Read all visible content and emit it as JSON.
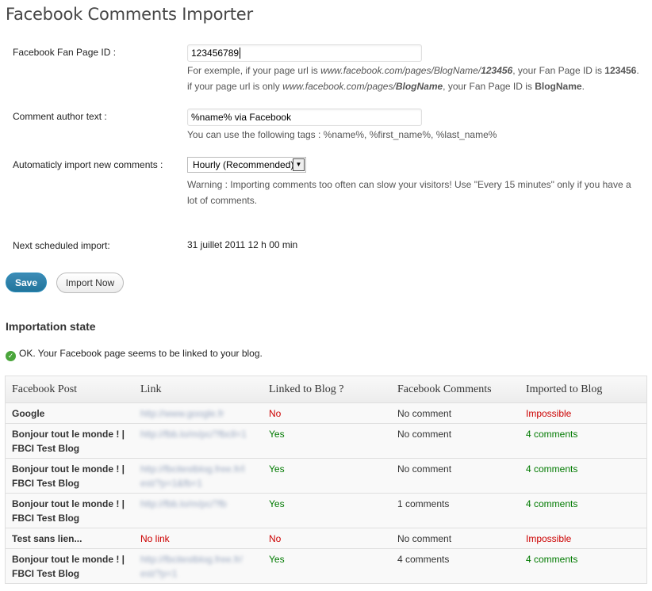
{
  "title": "Facebook Comments Importer",
  "form": {
    "fanpage_label": "Facebook Fan Page ID :",
    "fanpage_value": "123456789",
    "fanpage_help_1_a": "For exemple, if your page url is ",
    "fanpage_help_1_b": "www.facebook.com/pages/BlogName/",
    "fanpage_help_1_c": "123456",
    "fanpage_help_1_d": ", your Fan Page ID is ",
    "fanpage_help_1_e": "123456",
    "fanpage_help_1_f": ".",
    "fanpage_help_2_a": "if your page url is only ",
    "fanpage_help_2_b": "www.facebook.com/pages/",
    "fanpage_help_2_c": "BlogName",
    "fanpage_help_2_d": ", your Fan Page ID is ",
    "fanpage_help_2_e": "BlogName",
    "fanpage_help_2_f": ".",
    "author_label": "Comment author text :",
    "author_value": "%name% via Facebook",
    "author_help": "You can use the following tags : %name%, %first_name%, %last_name%",
    "auto_label": "Automaticly import new comments :",
    "auto_value": "Hourly (Recommended)",
    "auto_warning_1": "Warning : Importing comments too often can slow your visitors! Use \"Every 15 minutes\" only if you have a",
    "auto_warning_2": "lot of comments.",
    "next_label": "Next scheduled import:",
    "next_value": "31 juillet 2011 12 h 00 min"
  },
  "buttons": {
    "save": "Save",
    "import": "Import Now"
  },
  "state": {
    "heading": "Importation state",
    "status": "OK. Your Facebook page seems to be linked to your blog."
  },
  "table": {
    "headers": [
      "Facebook Post",
      "Link",
      "Linked to Blog ?",
      "Facebook Comments",
      "Imported to Blog"
    ],
    "rows": [
      {
        "post_1": "Google",
        "post_2": "",
        "link_1": "http://www.google.fr",
        "link_2": "",
        "linked": "No",
        "fb": "No comment",
        "imported": "Impossible"
      },
      {
        "post_1": "Bonjour tout le monde ! |",
        "post_2": "FBCI Test Blog",
        "link_1": "http://fbb.lo/m/pc/?fbcll=1",
        "link_2": "",
        "linked": "Yes",
        "fb": "No comment",
        "imported": "4 comments"
      },
      {
        "post_1": "Bonjour tout le monde ! |",
        "post_2": "FBCI Test Blog",
        "link_1": "http://fbcitestblog.free.fr/l",
        "link_2": "est/?p=1&fb=1",
        "linked": "Yes",
        "fb": "No comment",
        "imported": "4 comments"
      },
      {
        "post_1": "Bonjour tout le monde ! |",
        "post_2": "FBCI Test Blog",
        "link_1": "http://fbb.lo/m/pc/?fb",
        "link_2": "",
        "linked": "Yes",
        "fb": "1 comments",
        "imported": "4 comments"
      },
      {
        "post_1": "Test sans lien...",
        "post_2": "",
        "link_1": "No link",
        "link_2": "",
        "linked": "No",
        "fb": "No comment",
        "imported": "Impossible"
      },
      {
        "post_1": "Bonjour tout le monde ! |",
        "post_2": "FBCI Test Blog",
        "link_1": "http://fbcitestblog.free.fr/",
        "link_2": "est/?p=1",
        "linked": "Yes",
        "fb": "4 comments",
        "imported": "4 comments"
      }
    ]
  },
  "colors": {
    "primary": "#21759b",
    "error": "#cc0000",
    "success": "#007a00",
    "ok_icon": "#4aa53b"
  },
  "icons": {
    "ok": "check-circle-icon",
    "dropdown": "chevron-down-icon"
  }
}
